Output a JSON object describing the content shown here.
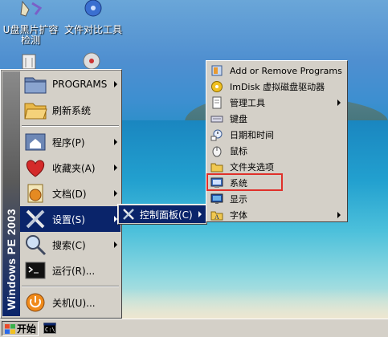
{
  "desktop": {
    "icons": [
      {
        "label": "U盘黑片扩容\n检测",
        "icon": "usb-tool-icon"
      },
      {
        "label": "文件对比工具",
        "icon": "disc-compare-icon"
      }
    ]
  },
  "start_menu": {
    "banner": "Windows PE 2003",
    "items": [
      {
        "label": "PROGRAMS",
        "icon": "folder-icon",
        "submenu": true
      },
      {
        "label": "刷新系统",
        "icon": "open-folder-icon",
        "submenu": false
      },
      {
        "label": "程序(P)",
        "icon": "programs-icon",
        "submenu": true
      },
      {
        "label": "收藏夹(A)",
        "icon": "favorites-heart-icon",
        "submenu": true
      },
      {
        "label": "文档(D)",
        "icon": "documents-icon",
        "submenu": true
      },
      {
        "label": "设置(S)",
        "icon": "settings-tools-icon",
        "submenu": true
      },
      {
        "label": "搜索(C)",
        "icon": "search-magnifier-icon",
        "submenu": true
      },
      {
        "label": "运行(R)...",
        "icon": "run-cmd-icon",
        "submenu": false
      },
      {
        "label": "关机(U)...",
        "icon": "shutdown-icon",
        "submenu": false
      }
    ]
  },
  "settings_submenu": {
    "items": [
      {
        "label": "控制面板(C)",
        "icon": "control-panel-icon",
        "submenu": true
      }
    ]
  },
  "control_panel_submenu": {
    "items": [
      {
        "label": "Add or Remove Programs",
        "icon": "add-remove-programs-icon",
        "submenu": false
      },
      {
        "label": "ImDisk 虚拟磁盘驱动器",
        "icon": "imdisk-icon",
        "submenu": false
      },
      {
        "label": "管理工具",
        "icon": "admin-tools-icon",
        "submenu": true
      },
      {
        "label": "键盘",
        "icon": "keyboard-icon",
        "submenu": false
      },
      {
        "label": "日期和时间",
        "icon": "date-time-icon",
        "submenu": false
      },
      {
        "label": "鼠标",
        "icon": "mouse-icon",
        "submenu": false
      },
      {
        "label": "文件夹选项",
        "icon": "folder-options-icon",
        "submenu": false
      },
      {
        "label": "系统",
        "icon": "system-icon",
        "submenu": false
      },
      {
        "label": "显示",
        "icon": "display-icon",
        "submenu": false
      },
      {
        "label": "字体",
        "icon": "fonts-icon",
        "submenu": true
      }
    ]
  },
  "taskbar": {
    "start_label": "开始",
    "task_icon": "cmd-window-icon"
  },
  "colors": {
    "menu_bg": "#d4d0c8",
    "selection": "#0a246a",
    "highlight_box": "#e0302a"
  }
}
